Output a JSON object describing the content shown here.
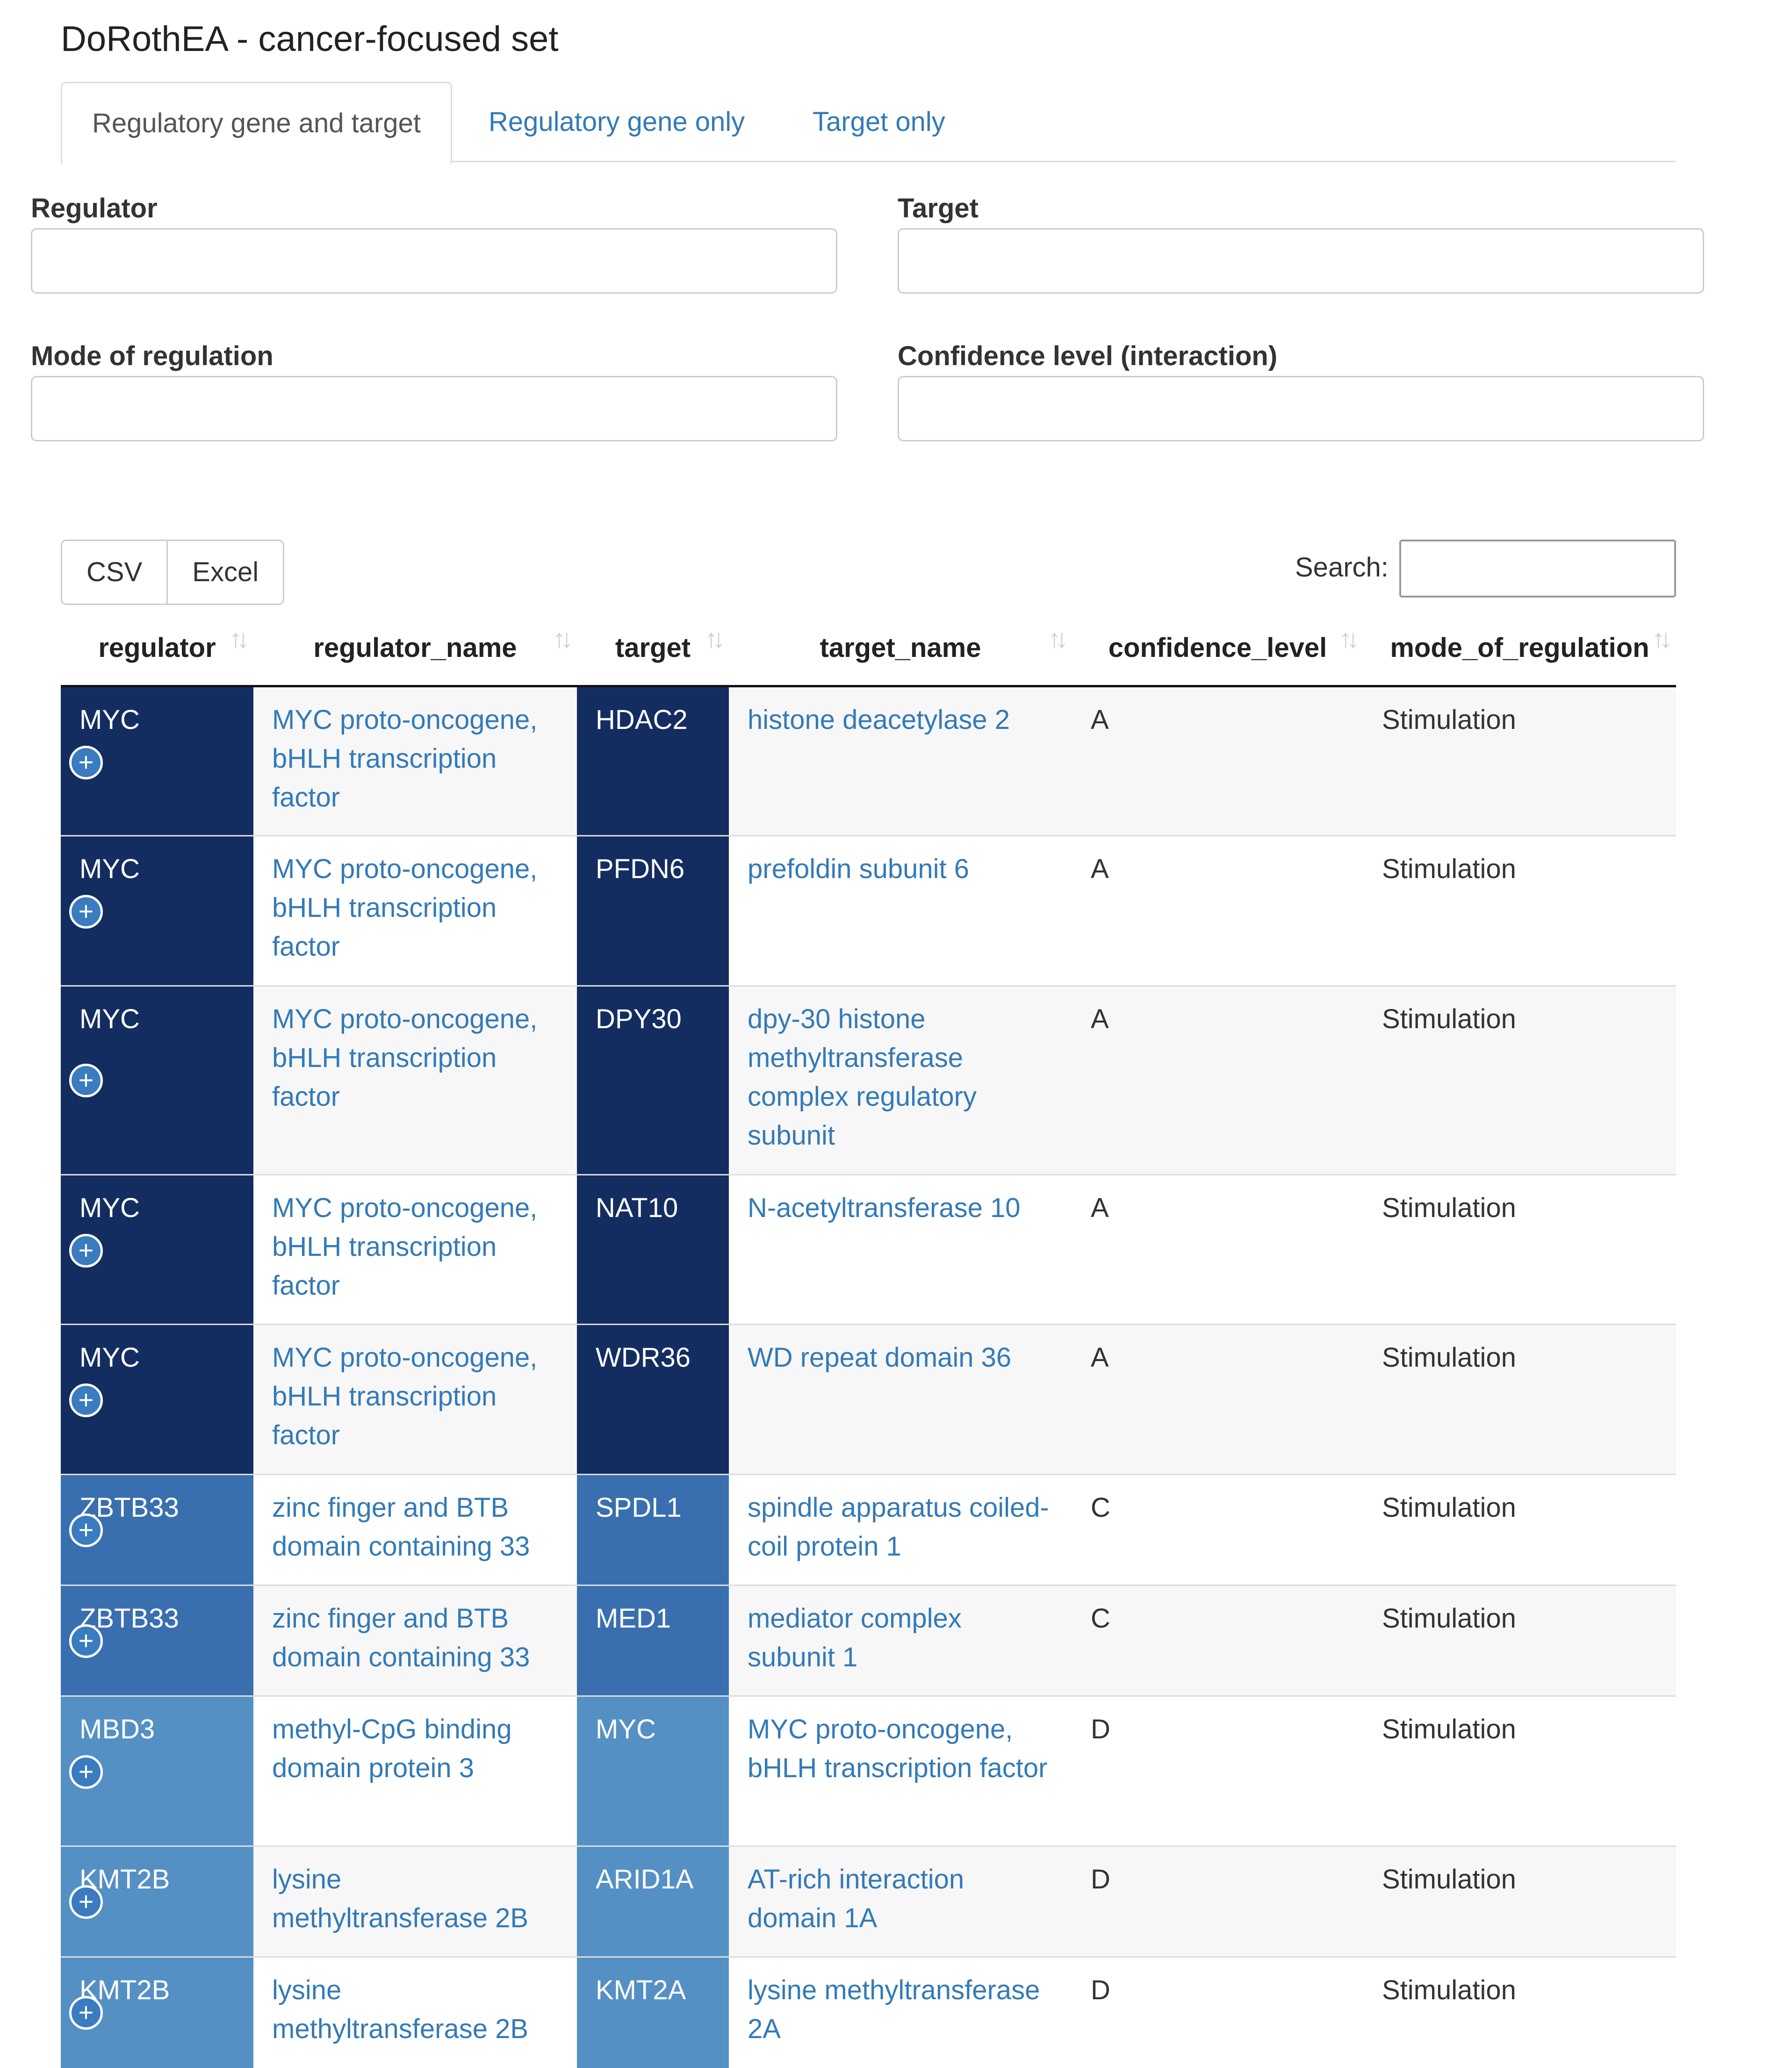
{
  "page": {
    "title": "DoRothEA - cancer-focused set"
  },
  "tabs": [
    {
      "label": "Regulatory gene and target",
      "active": true
    },
    {
      "label": "Regulatory gene only",
      "active": false
    },
    {
      "label": "Target only",
      "active": false
    }
  ],
  "filters": {
    "regulator": {
      "label": "Regulator",
      "value": ""
    },
    "target": {
      "label": "Target",
      "value": ""
    },
    "mode": {
      "label": "Mode of regulation",
      "value": ""
    },
    "confidence": {
      "label": "Confidence level (interaction)",
      "value": ""
    }
  },
  "toolbar": {
    "csv_label": "CSV",
    "excel_label": "Excel",
    "search_label": "Search:",
    "search_value": ""
  },
  "columns": [
    "regulator",
    "regulator_name",
    "target",
    "target_name",
    "confidence_level",
    "mode_of_regulation"
  ],
  "colors": {
    "shade_dark": "#142d61",
    "shade_mid": "#3a6faf",
    "shade_light": "#5590c4",
    "link": "#337ab7"
  },
  "rows": [
    {
      "regulator": "MYC",
      "regulator_name": "MYC proto-oncogene, bHLH transcription factor",
      "target": "HDAC2",
      "target_name": "histone deacetylase 2",
      "confidence_level": "A",
      "mode_of_regulation": "Stimulation"
    },
    {
      "regulator": "MYC",
      "regulator_name": "MYC proto-oncogene, bHLH transcription factor",
      "target": "PFDN6",
      "target_name": "prefoldin subunit 6",
      "confidence_level": "A",
      "mode_of_regulation": "Stimulation"
    },
    {
      "regulator": "MYC",
      "regulator_name": "MYC proto-oncogene, bHLH transcription factor",
      "target": "DPY30",
      "target_name": "dpy-30 histone methyltransferase complex regulatory subunit",
      "confidence_level": "A",
      "mode_of_regulation": "Stimulation"
    },
    {
      "regulator": "MYC",
      "regulator_name": "MYC proto-oncogene, bHLH transcription factor",
      "target": "NAT10",
      "target_name": "N-acetyltransferase 10",
      "confidence_level": "A",
      "mode_of_regulation": "Stimulation"
    },
    {
      "regulator": "MYC",
      "regulator_name": "MYC proto-oncogene, bHLH transcription factor",
      "target": "WDR36",
      "target_name": "WD repeat domain 36",
      "confidence_level": "A",
      "mode_of_regulation": "Stimulation"
    },
    {
      "regulator": "ZBTB33",
      "regulator_name": "zinc finger and BTB domain containing 33",
      "target": "SPDL1",
      "target_name": "spindle apparatus coiled-coil protein 1",
      "confidence_level": "C",
      "mode_of_regulation": "Stimulation"
    },
    {
      "regulator": "ZBTB33",
      "regulator_name": "zinc finger and BTB domain containing 33",
      "target": "MED1",
      "target_name": "mediator complex subunit 1",
      "confidence_level": "C",
      "mode_of_regulation": "Stimulation"
    },
    {
      "regulator": "MBD3",
      "regulator_name": "methyl-CpG binding domain protein 3",
      "target": "MYC",
      "target_name": "MYC proto-oncogene, bHLH transcription factor",
      "confidence_level": "D",
      "mode_of_regulation": "Stimulation"
    },
    {
      "regulator": "KMT2B",
      "regulator_name": "lysine methyltransferase 2B",
      "target": "ARID1A",
      "target_name": "AT-rich interaction domain 1A",
      "confidence_level": "D",
      "mode_of_regulation": "Stimulation"
    },
    {
      "regulator": "KMT2B",
      "regulator_name": "lysine methyltransferase 2B",
      "target": "KMT2A",
      "target_name": "lysine methyltransferase 2A",
      "confidence_level": "D",
      "mode_of_regulation": "Stimulation"
    }
  ]
}
